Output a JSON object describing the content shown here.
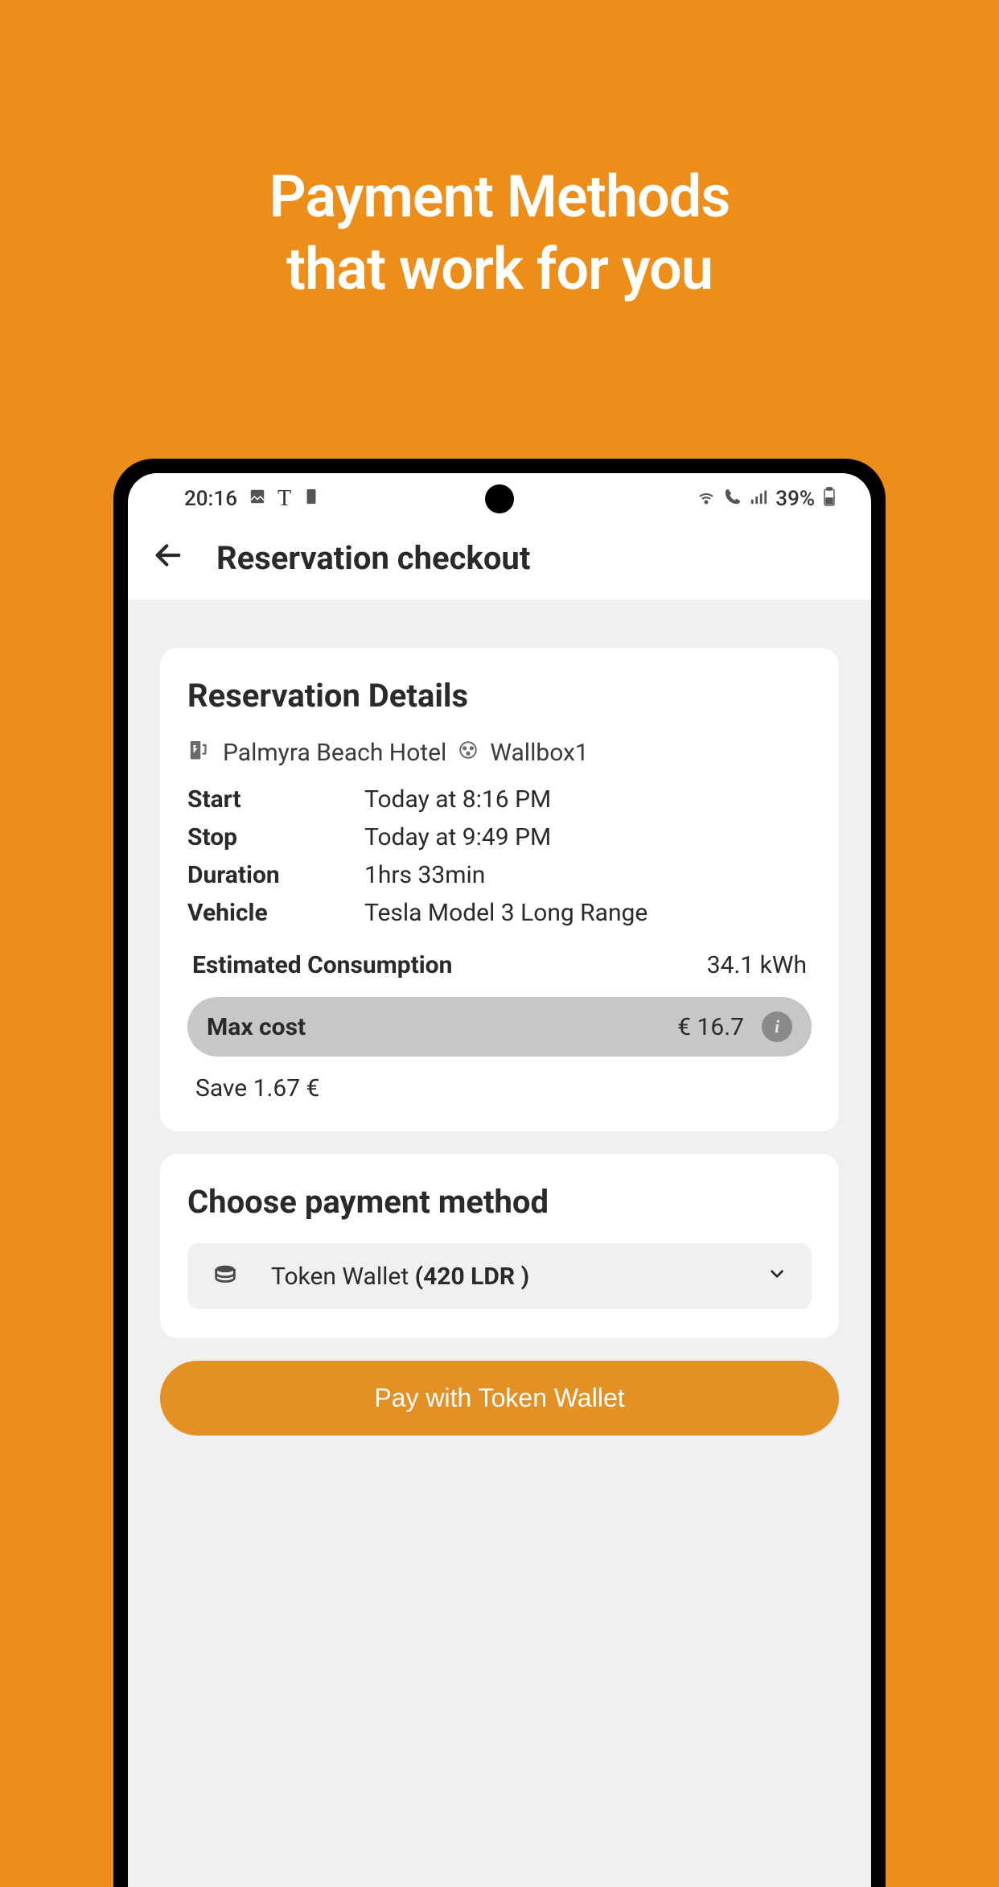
{
  "hero": {
    "line1": "Payment Methods",
    "line2": "that work for you"
  },
  "statusBar": {
    "time": "20:16",
    "battery": "39%"
  },
  "header": {
    "title": "Reservation checkout"
  },
  "details": {
    "title": "Reservation Details",
    "location": "Palmyra Beach Hotel",
    "charger": "Wallbox1",
    "rows": {
      "start": {
        "label": "Start",
        "value": "Today at 8:16 PM"
      },
      "stop": {
        "label": "Stop",
        "value": "Today at 9:49 PM"
      },
      "duration": {
        "label": "Duration",
        "value": "1hrs 33min"
      },
      "vehicle": {
        "label": "Vehicle",
        "value": "Tesla Model 3 Long Range"
      }
    },
    "consumption": {
      "label": "Estimated Consumption",
      "value": "34.1 kWh"
    },
    "maxCost": {
      "label": "Max cost",
      "value": "€ 16.7"
    },
    "save": "Save 1.67 €"
  },
  "payment": {
    "title": "Choose payment method",
    "selectedPrefix": "Token Wallet ",
    "selectedBold": "(420 LDR )"
  },
  "button": {
    "label": "Pay with Token Wallet"
  }
}
